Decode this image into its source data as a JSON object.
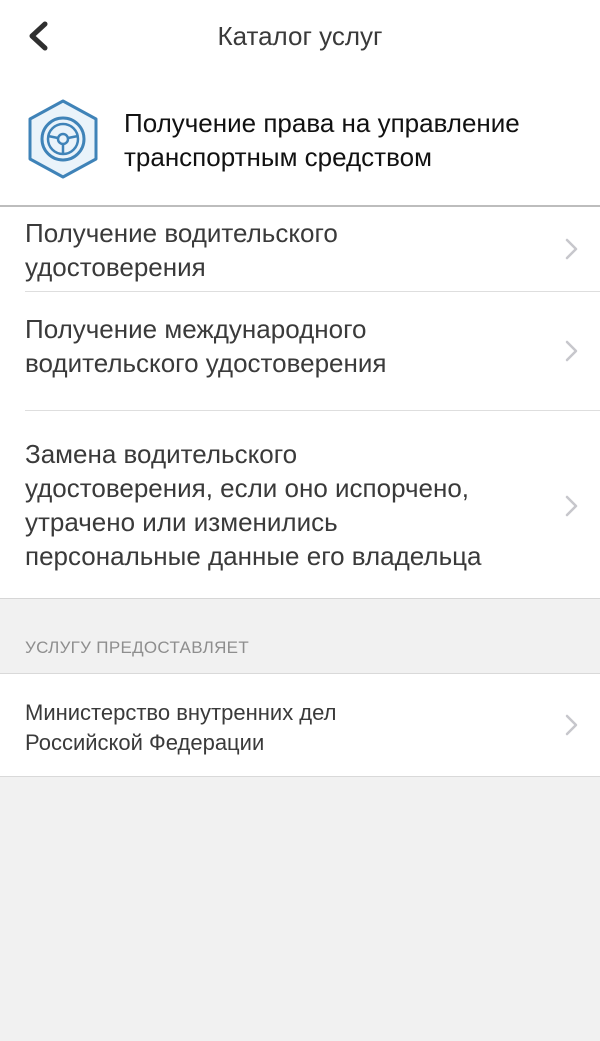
{
  "nav": {
    "title": "Каталог услуг",
    "back_icon": "chevron-left-icon"
  },
  "service": {
    "icon": "steering-wheel-icon",
    "title_line1": "Получение права на управление",
    "title_line2": "транспортным средством"
  },
  "subservices": [
    {
      "line1": "Получение водительского",
      "line2": "удостоверения"
    },
    {
      "line1": "Получение международного",
      "line2": "водительского удостоверения"
    },
    {
      "line1": "Замена водительского",
      "line2": "удостоверения, если оно испорчено,",
      "line3": "утрачено или изменились",
      "line4": "персональные данные его владельца"
    }
  ],
  "provider_section": {
    "header": "УСЛУГУ ПРЕДОСТАВЛЯЕТ",
    "line1": "Министерство внутренних дел",
    "line2": "Российской Федерации"
  },
  "colors": {
    "accent": "#3f83b8",
    "background": "#f1f1f1"
  }
}
